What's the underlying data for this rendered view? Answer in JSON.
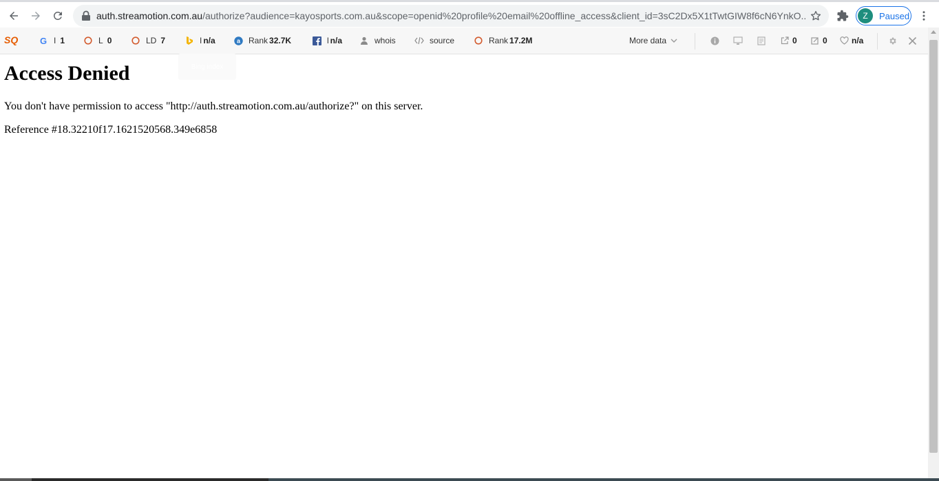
{
  "browser": {
    "url_host": "auth.streamotion.com.au",
    "url_rest": "/authorize?audience=kayosports.com.au&scope=openid%20profile%20email%20offline_access&client_id=3sC2Dx5X1tTwtGIW8f6cN6YnkO...",
    "profile_initial": "Z",
    "profile_status": "Paused"
  },
  "seoquake": {
    "logo": "SQ",
    "items": [
      {
        "icon": "google-icon",
        "label": "I",
        "value": "1"
      },
      {
        "icon": "semrush-icon",
        "label": "L",
        "value": "0"
      },
      {
        "icon": "semrush-icon",
        "label": "LD",
        "value": "7"
      },
      {
        "icon": "bing-icon",
        "label": "I",
        "value": "n/a"
      },
      {
        "icon": "alexa-icon",
        "label": "Rank",
        "value": "32.7K"
      },
      {
        "icon": "facebook-icon",
        "label": "l",
        "value": "n/a"
      },
      {
        "icon": "whois-icon",
        "label": "whois",
        "value": ""
      },
      {
        "icon": "source-icon",
        "label": "source",
        "value": ""
      },
      {
        "icon": "semrush-icon",
        "label": "Rank",
        "value": "17.2M"
      }
    ],
    "more_data": "More data",
    "right_values": {
      "external_links": "0",
      "internal_links": "0",
      "health": "n/a"
    },
    "tooltip": "Bing index"
  },
  "page": {
    "heading": "Access Denied",
    "message": "You don't have permission to access \"http://auth.streamotion.com.au/authorize?\" on this server.",
    "reference": "Reference #18.32210f17.1621520568.349e6858"
  },
  "colors": {
    "accent": "#1a73e8",
    "semrush": "#d35b2e",
    "google_blue": "#4285f4"
  }
}
